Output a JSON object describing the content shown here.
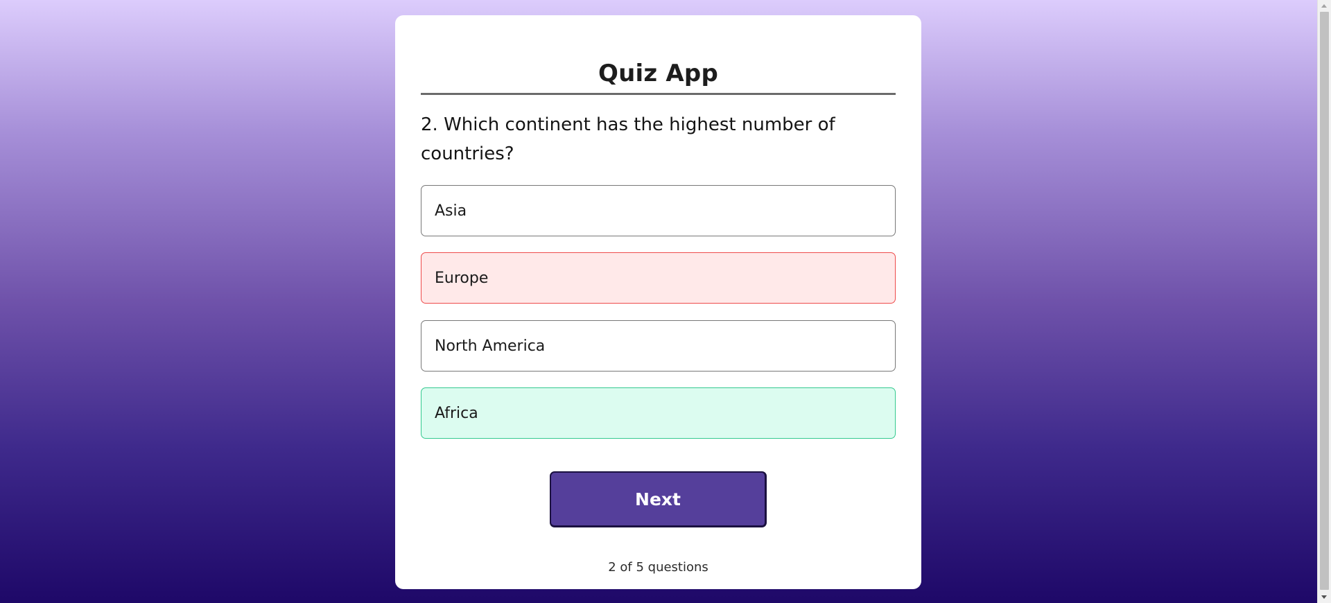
{
  "app": {
    "title": "Quiz App"
  },
  "question": {
    "text": "2. Which continent has the highest number of countries?"
  },
  "options": [
    {
      "label": "Asia",
      "state": "default"
    },
    {
      "label": "Europe",
      "state": "wrong"
    },
    {
      "label": "North America",
      "state": "default"
    },
    {
      "label": "Africa",
      "state": "correct"
    }
  ],
  "actions": {
    "next_label": "Next"
  },
  "progress": {
    "text": "2 of 5 questions"
  },
  "colors": {
    "primary": "#553f9b",
    "wrong_bg": "#ffe9e9",
    "wrong_border": "#ee4a4a",
    "correct_bg": "#dcfcf0",
    "correct_border": "#33c98f"
  },
  "icons": {
    "scroll_up": "scroll-up-arrow-icon",
    "scroll_down": "scroll-down-arrow-icon"
  }
}
